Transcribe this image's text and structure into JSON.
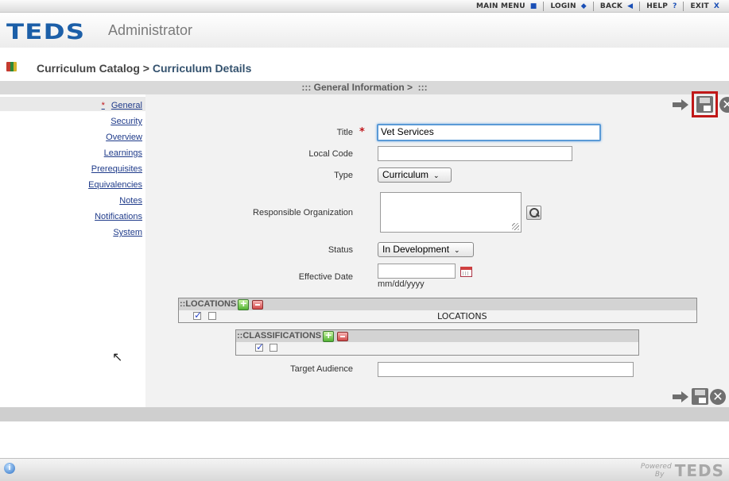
{
  "topnav": {
    "main_menu": "MAIN MENU",
    "login": "LOGIN",
    "back": "BACK",
    "help": "HELP",
    "exit": "EXIT"
  },
  "header": {
    "logo": "TEDS",
    "app_name": "Administrator"
  },
  "breadcrumb": {
    "parent": "Curriculum Catalog",
    "separator": " > ",
    "current": "Curriculum Details"
  },
  "section_title": "::: General Information >  :::",
  "sidebar": {
    "required_marker": "*",
    "items": [
      {
        "label": "General"
      },
      {
        "label": "Security"
      },
      {
        "label": "Overview"
      },
      {
        "label": "Learnings"
      },
      {
        "label": "Prerequisites"
      },
      {
        "label": "Equivalencies"
      },
      {
        "label": "Notes"
      },
      {
        "label": "Notifications"
      },
      {
        "label": "System"
      }
    ]
  },
  "form": {
    "title": {
      "label": "Title",
      "value": "Vet Services",
      "required_marker": "*"
    },
    "local_code": {
      "label": "Local Code",
      "value": ""
    },
    "type": {
      "label": "Type",
      "value": "Curriculum"
    },
    "responsible_org": {
      "label": "Responsible Organization",
      "value": ""
    },
    "status": {
      "label": "Status",
      "value": "In Development"
    },
    "effective_date": {
      "label": "Effective Date",
      "value": "",
      "format_hint": "mm/dd/yyyy"
    },
    "target_audience": {
      "label": "Target Audience",
      "value": ""
    }
  },
  "locations_panel": {
    "title": "::LOCATIONS",
    "column_header": "LOCATIONS"
  },
  "classifications_panel": {
    "title": "::CLASSIFICATIONS"
  },
  "footer": {
    "powered_line1": "Powered",
    "powered_line2": "By",
    "powered_logo": "TEDS"
  },
  "colors": {
    "brand_blue": "#1c5fa8",
    "required_red": "#c0151a",
    "highlight_red": "#c01818"
  }
}
